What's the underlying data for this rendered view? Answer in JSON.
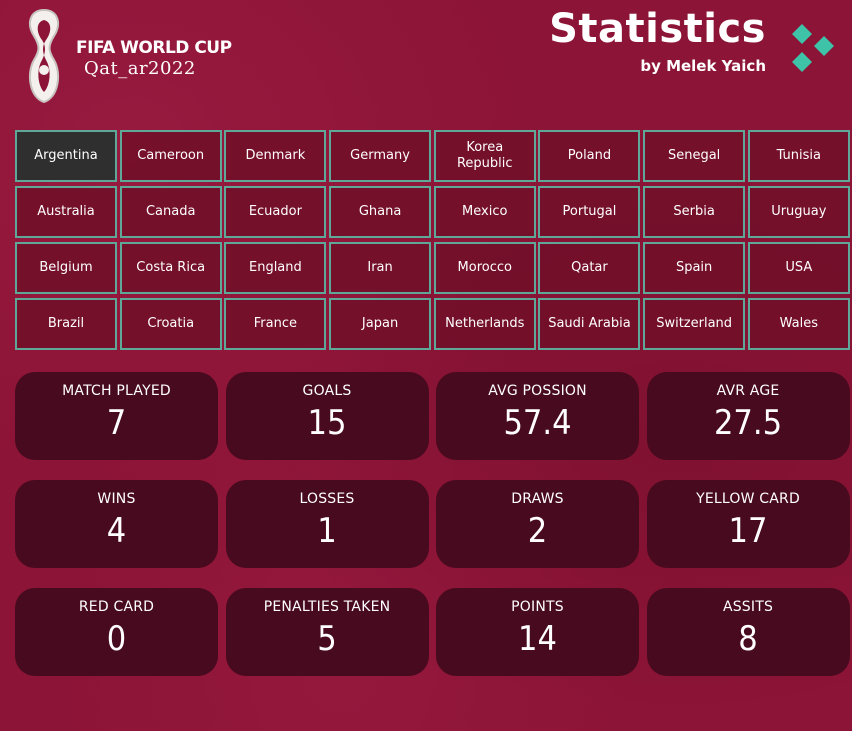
{
  "header": {
    "brand_line1": "FIFA WORLD CUP",
    "brand_line2": "Qat_ar2022",
    "title": "Statistics",
    "subtitle": "by Melek Yaich"
  },
  "colors": {
    "background": "#8c1436",
    "card": "#480a1f",
    "country_button": "#700f28",
    "country_border": "#5fa899",
    "selected": "#2f2f2f",
    "brand_mark": "#3fc3a8"
  },
  "icons": {
    "logo": "fifa-trophy-emblem-icon",
    "brand_mark": "diamond-cluster-icon"
  },
  "countries": [
    "Argentina",
    "Cameroon",
    "Denmark",
    "Germany",
    "Korea Republic",
    "Poland",
    "Senegal",
    "Tunisia",
    "Australia",
    "Canada",
    "Ecuador",
    "Ghana",
    "Mexico",
    "Portugal",
    "Serbia",
    "Uruguay",
    "Belgium",
    "Costa Rica",
    "England",
    "Iran",
    "Morocco",
    "Qatar",
    "Spain",
    "USA",
    "Brazil",
    "Croatia",
    "France",
    "Japan",
    "Netherlands",
    "Saudi Arabia",
    "Switzerland",
    "Wales"
  ],
  "selected_country": "Argentina",
  "stats": [
    {
      "label": "MATCH PLAYED",
      "value": "7"
    },
    {
      "label": "GOALS",
      "value": "15"
    },
    {
      "label": "AVG POSSION",
      "value": "57.4"
    },
    {
      "label": "AVR AGE",
      "value": "27.5"
    },
    {
      "label": "WINS",
      "value": "4"
    },
    {
      "label": "LOSSES",
      "value": "1"
    },
    {
      "label": "DRAWS",
      "value": "2"
    },
    {
      "label": "YELLOW CARD",
      "value": "17"
    },
    {
      "label": "RED CARD",
      "value": "0"
    },
    {
      "label": "PENALTIES TAKEN",
      "value": "5"
    },
    {
      "label": "POINTS",
      "value": "14"
    },
    {
      "label": "ASSITS",
      "value": "8"
    }
  ]
}
